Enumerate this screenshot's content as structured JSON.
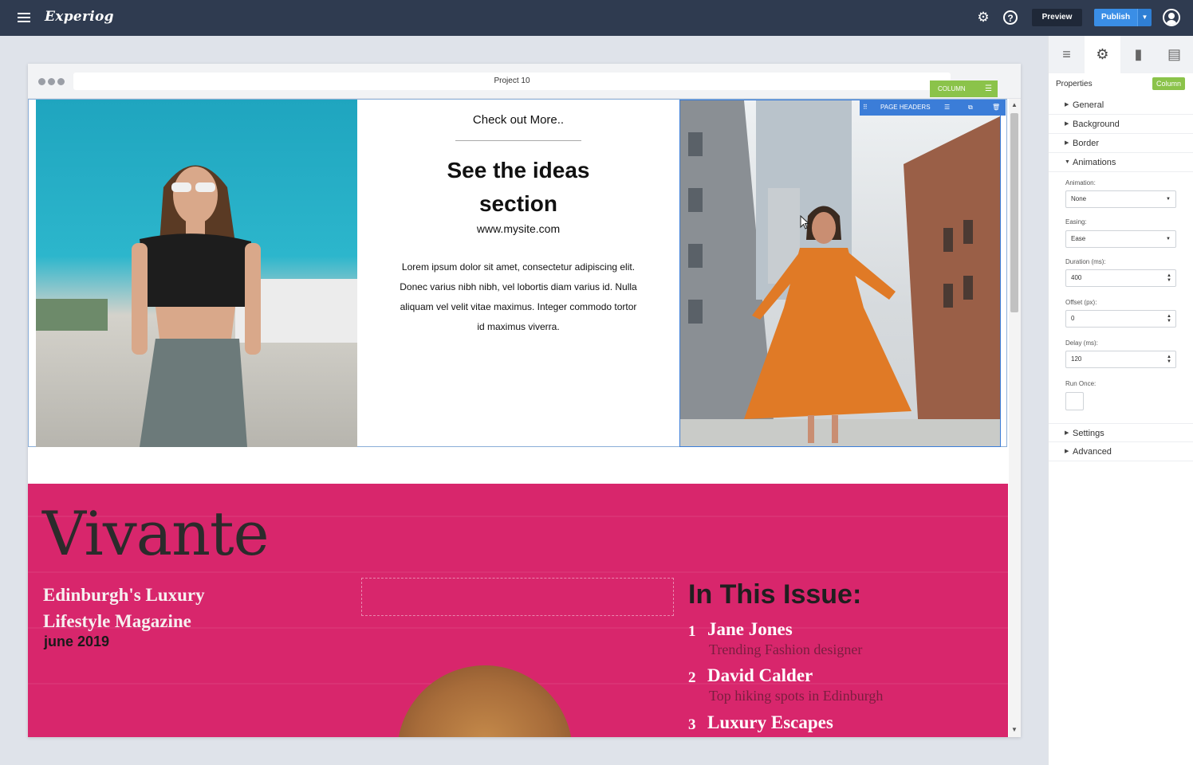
{
  "app": {
    "logo": "Experiog",
    "preview_label": "Preview",
    "publish_label": "Publish",
    "icons": [
      "menu-icon",
      "gear-icon",
      "help-icon",
      "caret-down-icon",
      "user-icon"
    ]
  },
  "browser": {
    "url_text": "Project 10"
  },
  "editor": {
    "column_tag": "COLUMN",
    "page_headers_label": "PAGE HEADERS"
  },
  "row1": {
    "check_more": "Check out More..",
    "heading": "See the ideas section",
    "site": "www.mysite.com",
    "body": "Lorem ipsum dolor sit amet, consectetur adipiscing elit. Donec varius nibh nibh, vel lobortis diam varius id. Nulla aliquam vel velit vitae maximus. Integer commodo tortor id maximus viverra."
  },
  "magazine": {
    "title": "Vivante",
    "subtitle": "Edinburgh's Luxury Lifestyle Magazine",
    "date": "june 2019",
    "issue_heading": "In This Issue:",
    "items": [
      {
        "num": "1",
        "name": "Jane Jones",
        "desc": "Trending Fashion designer"
      },
      {
        "num": "2",
        "name": "David Calder",
        "desc": "Top hiking spots in Edinburgh"
      },
      {
        "num": "3",
        "name": "Luxury Escapes",
        "desc": ""
      }
    ],
    "colors": {
      "background": "#d8266c"
    }
  },
  "panel": {
    "properties_label": "Properties",
    "badge": "Column",
    "sections": {
      "general": "General",
      "background": "Background",
      "border": "Border",
      "animations": "Animations",
      "settings": "Settings",
      "advanced": "Advanced"
    },
    "fields": {
      "animation_label": "Animation:",
      "animation_value": "None",
      "easing_label": "Easing:",
      "easing_value": "Ease",
      "duration_label": "Duration (ms):",
      "duration_value": "400",
      "offset_label": "Offset (px):",
      "offset_value": "0",
      "delay_label": "Delay (ms):",
      "delay_value": "120",
      "run_once_label": "Run Once:"
    },
    "tab_icons": [
      "add-element-icon",
      "settings-icon",
      "page-icon",
      "layout-icon"
    ]
  },
  "colors": {
    "topbar": "#2f3b50",
    "accent_blue": "#3a8ee6",
    "accent_green": "#8bc34a"
  }
}
